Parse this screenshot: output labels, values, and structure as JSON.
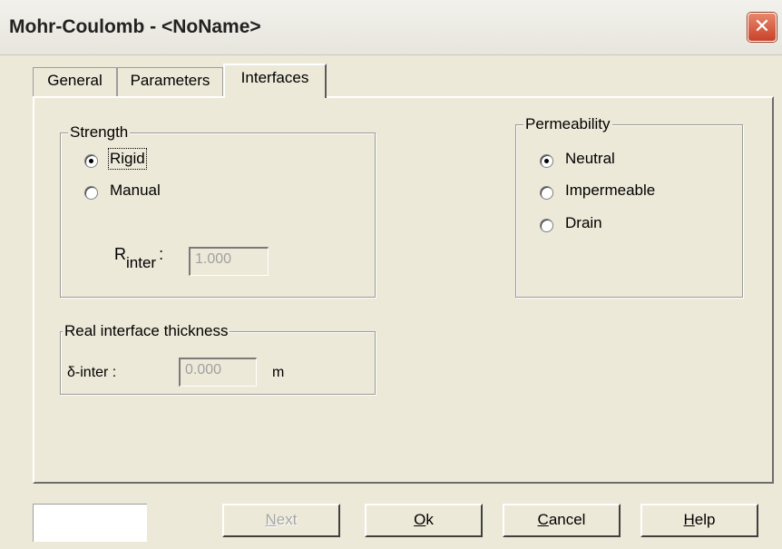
{
  "window": {
    "title": "Mohr-Coulomb - <NoName>",
    "close_glyph": "✕"
  },
  "tabs": [
    {
      "label": "General"
    },
    {
      "label": "Parameters"
    },
    {
      "label": "Interfaces",
      "active": true
    }
  ],
  "strength": {
    "legend": "Strength",
    "options": [
      {
        "label": "Rigid",
        "selected": true
      },
      {
        "label": "Manual",
        "selected": false
      }
    ],
    "rinter_label_main": "R",
    "rinter_label_sub": "inter",
    "rinter_colon": ":",
    "rinter_value": "1.000"
  },
  "permeability": {
    "legend": "Permeability",
    "options": [
      {
        "label": "Neutral",
        "selected": true
      },
      {
        "label": "Impermeable",
        "selected": false
      },
      {
        "label": "Drain",
        "selected": false
      }
    ]
  },
  "thickness": {
    "legend": "Real interface thickness",
    "label": "δ-inter :",
    "value": "0.000",
    "unit": "m"
  },
  "buttons": {
    "next": {
      "first": "N",
      "rest": "ext"
    },
    "ok": {
      "first": "O",
      "rest": "k"
    },
    "cancel": {
      "first": "C",
      "rest": "ancel"
    },
    "help": {
      "first": "H",
      "rest": "elp"
    }
  },
  "colors": {
    "close_button": "#c8432a",
    "dialog_face": "#ece9d8"
  }
}
